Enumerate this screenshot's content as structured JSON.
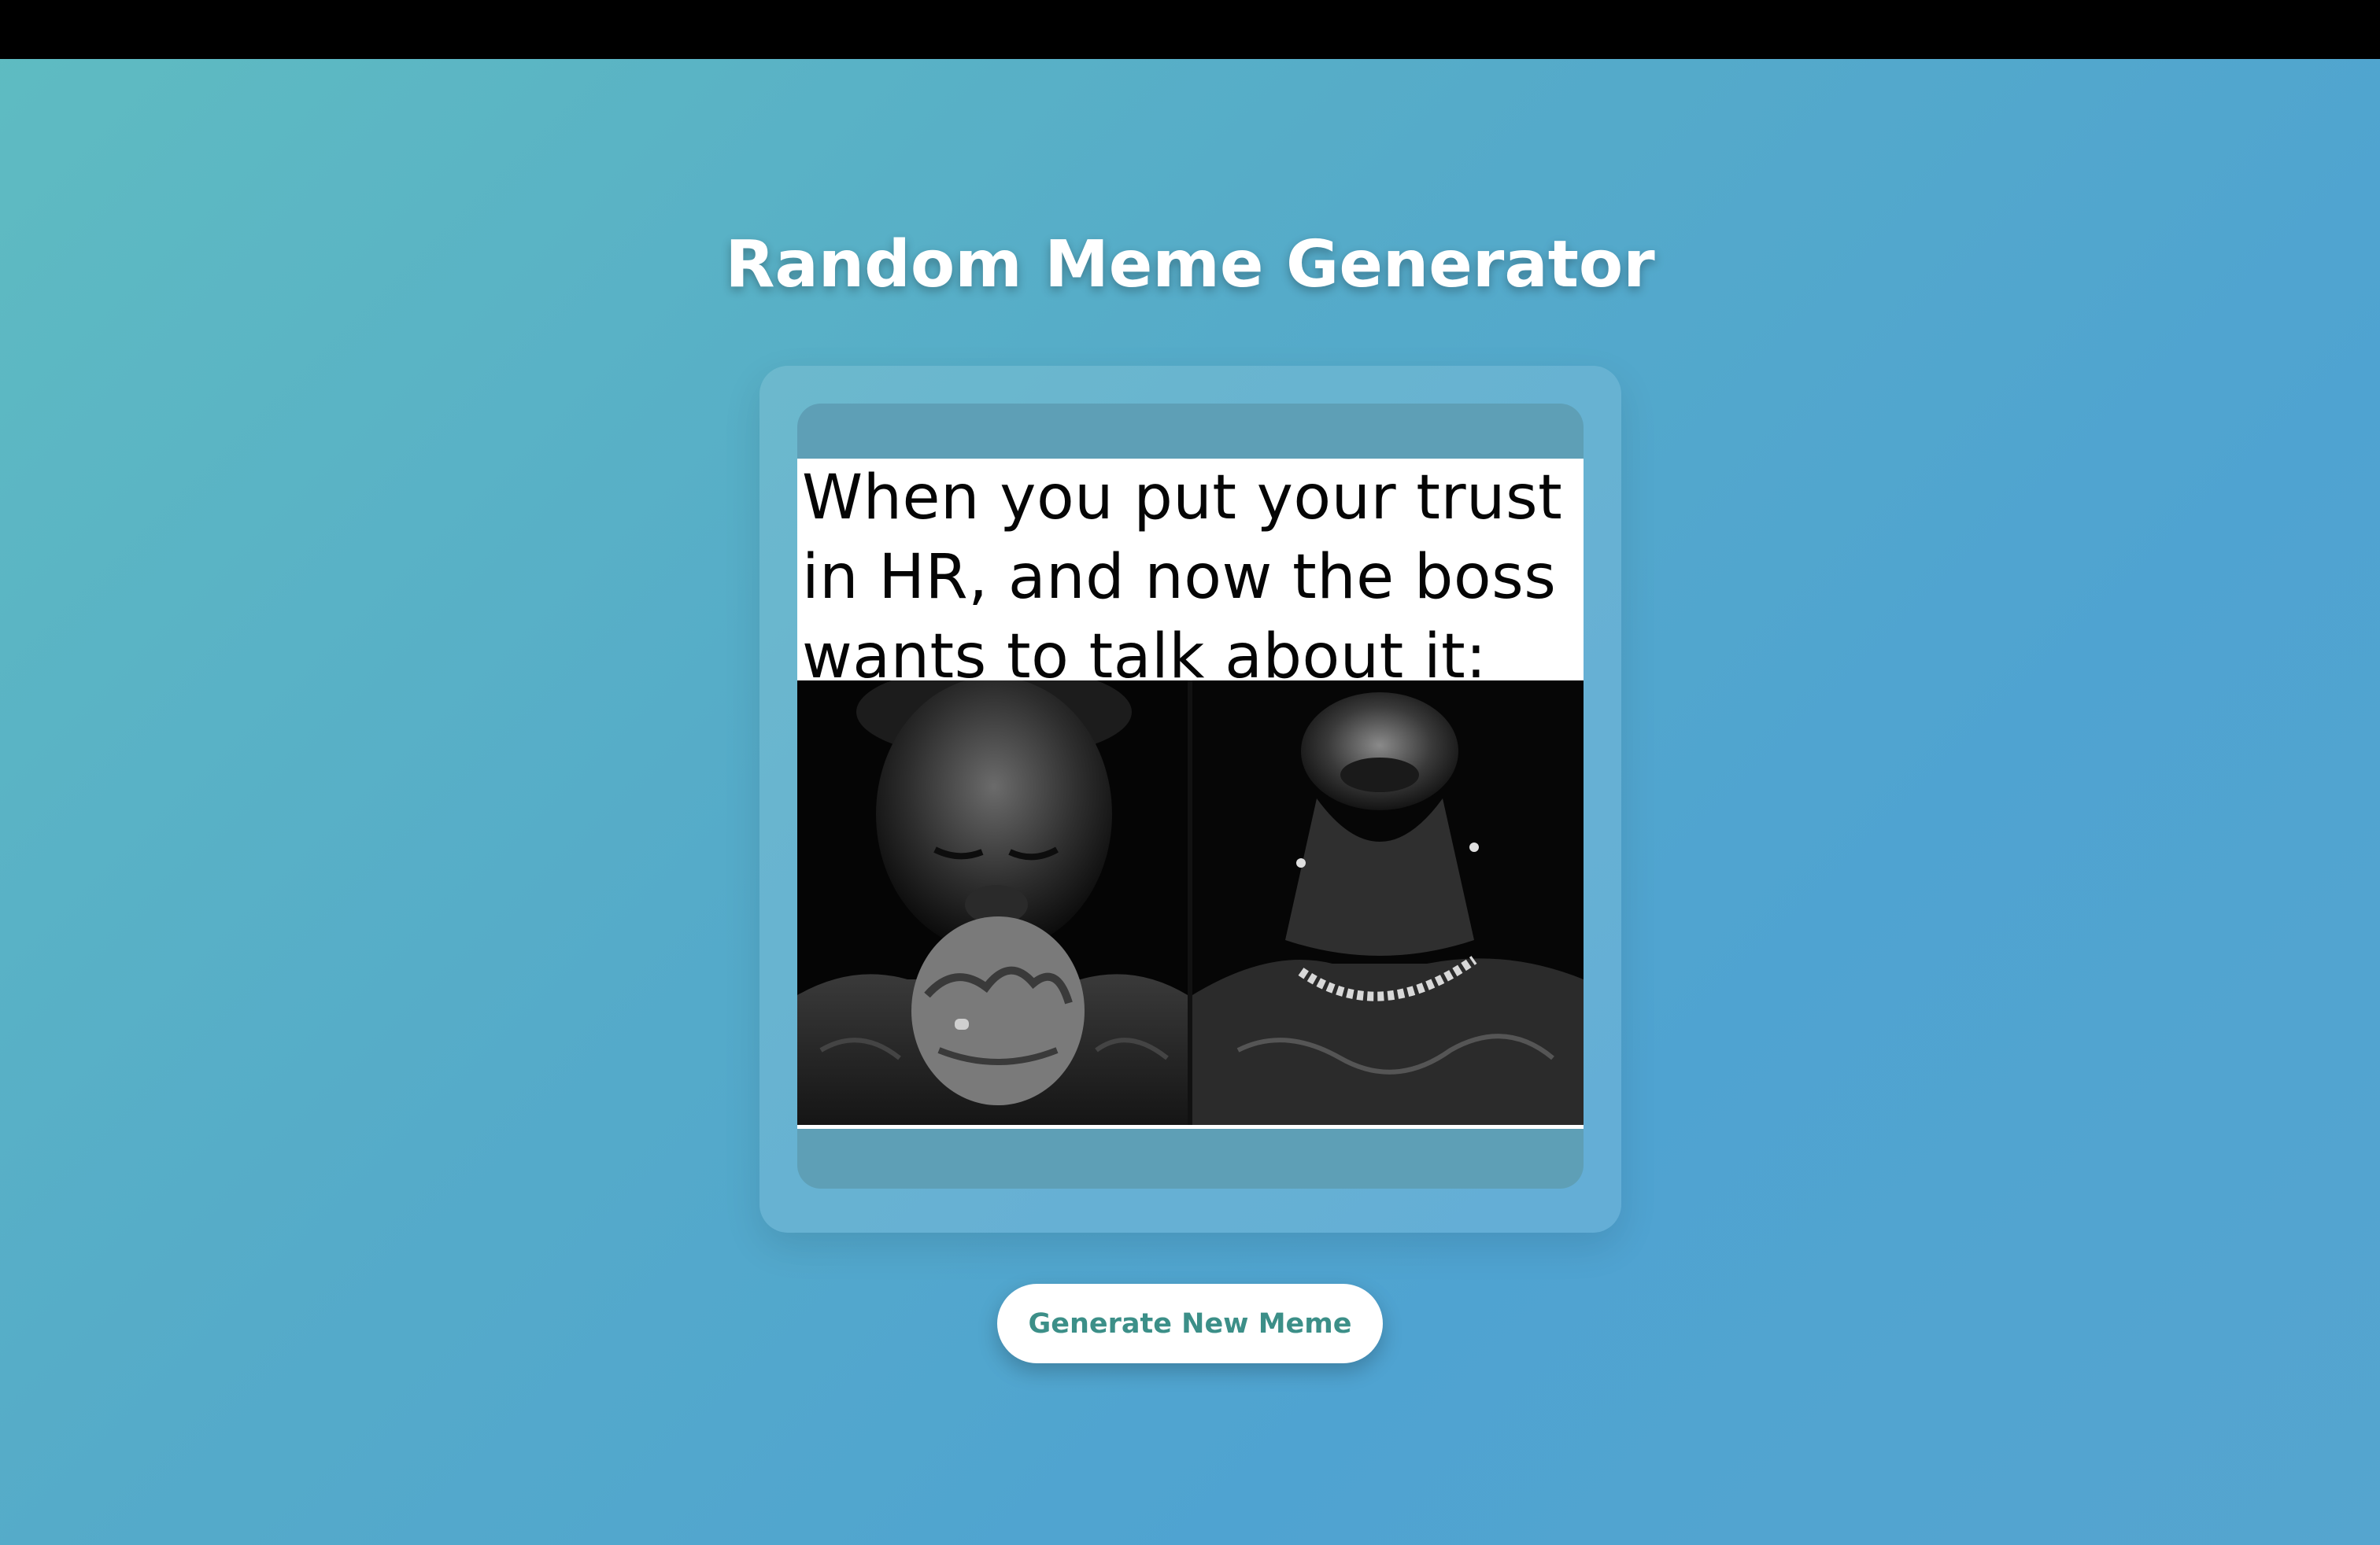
{
  "page": {
    "title": "Random Meme Generator"
  },
  "meme": {
    "caption": "When you put your trust\nin HR, and now the boss\nwants to talk about it:"
  },
  "actions": {
    "generate_label": "Generate New Meme"
  },
  "colors": {
    "background_start": "#5fbcc1",
    "background_end": "#4fa3d1",
    "button_text": "#3c8f88",
    "title_text": "#ffffff",
    "top_bar": "#000000"
  }
}
